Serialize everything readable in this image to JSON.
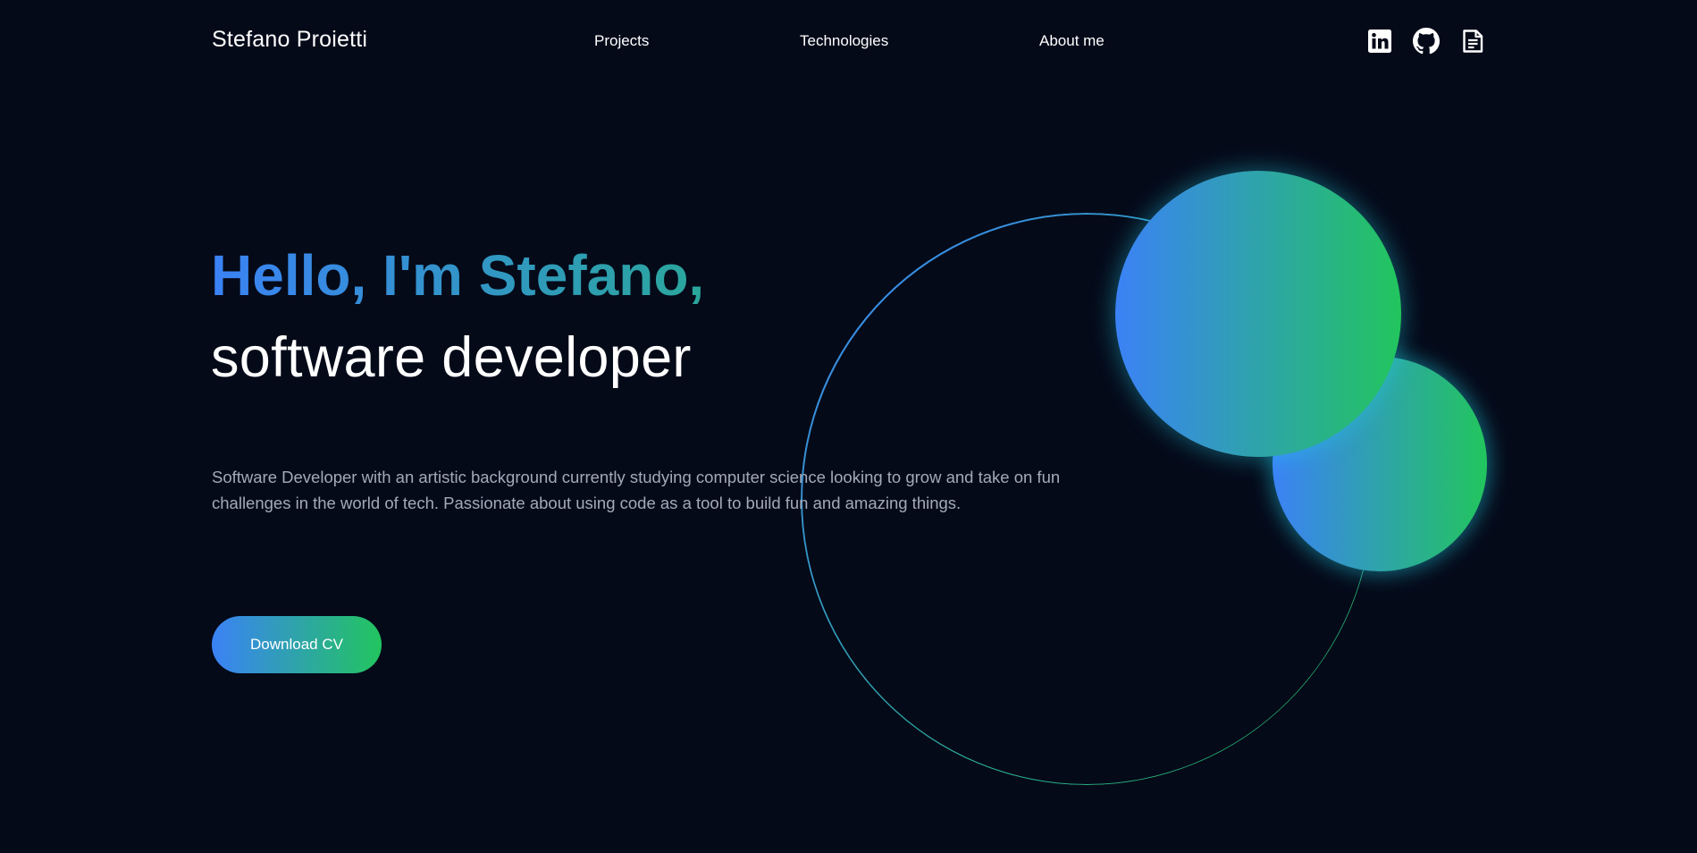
{
  "header": {
    "brand": "Stefano Proietti",
    "nav": {
      "projects": "Projects",
      "technologies": "Technologies",
      "about": "About me"
    },
    "social_icons": [
      "linkedin-icon",
      "github-icon",
      "resume-icon"
    ]
  },
  "hero": {
    "greeting": "Hello, I'm Stefano,",
    "role": "software developer",
    "description": "Software Developer with an artistic background currently studying computer science looking to grow and take on fun challenges in the world of tech. Passionate about using code as a tool to build fun and amazing things.",
    "cta_label": "Download CV"
  },
  "theme": {
    "background": "#050a19",
    "gradient_start": "#3b82f6",
    "gradient_end": "#22c55e",
    "description_color": "#a2aab8"
  }
}
